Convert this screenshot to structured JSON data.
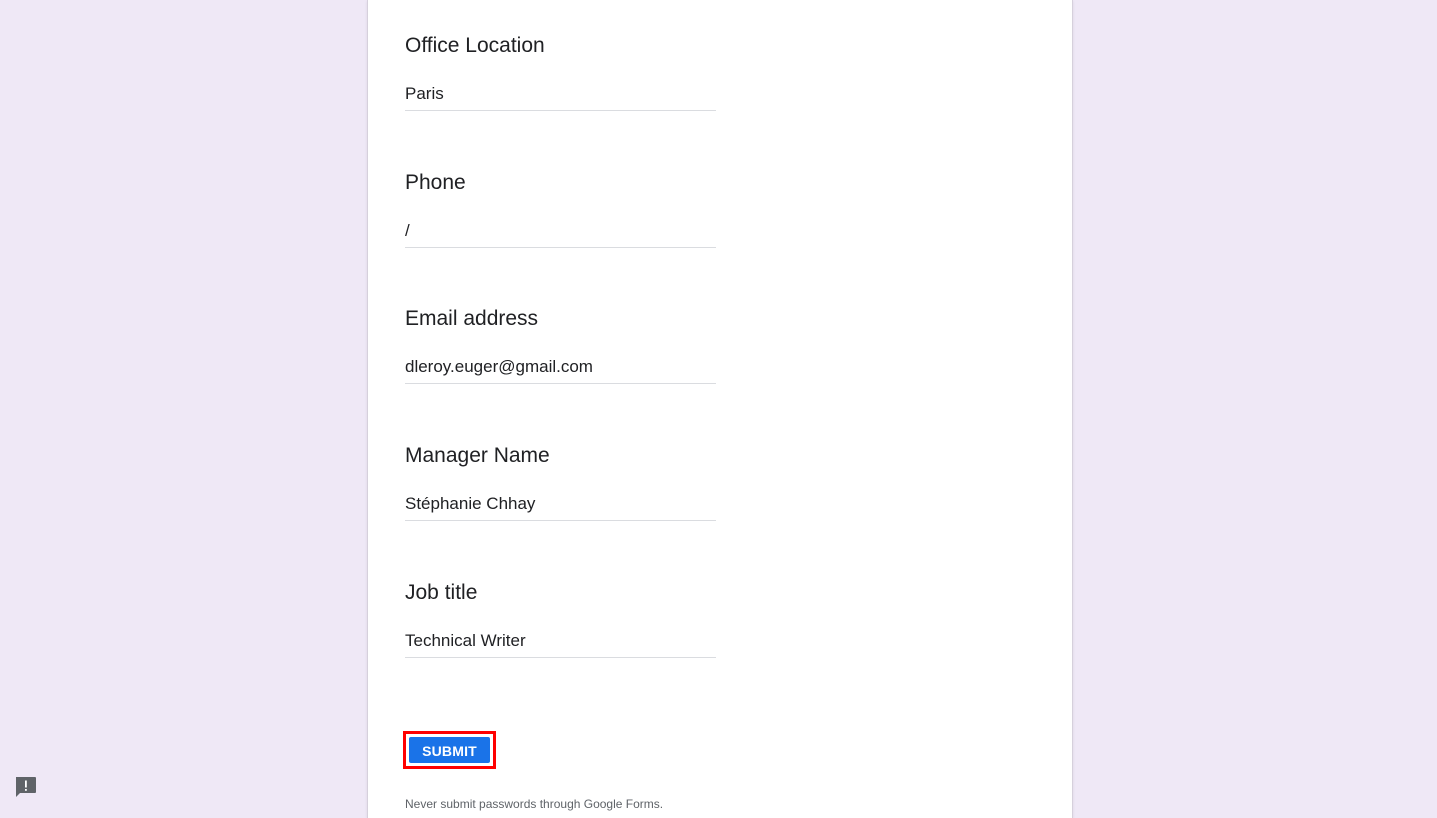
{
  "form": {
    "questions": [
      {
        "title": "Office Location",
        "answer": "Paris"
      },
      {
        "title": "Phone",
        "answer": "/"
      },
      {
        "title": "Email address",
        "answer": "dleroy.euger@gmail.com"
      },
      {
        "title": "Manager Name",
        "answer": "Stéphanie Chhay"
      },
      {
        "title": "Job title",
        "answer": "Technical Writer"
      }
    ],
    "submit_label": "SUBMIT",
    "footer_note": "Never submit passwords through Google Forms."
  },
  "feedback": {
    "icon": "report-feedback-icon"
  },
  "colors": {
    "background": "#efe8f6",
    "accent": "#1a73e8",
    "highlight": "#ff0000"
  }
}
